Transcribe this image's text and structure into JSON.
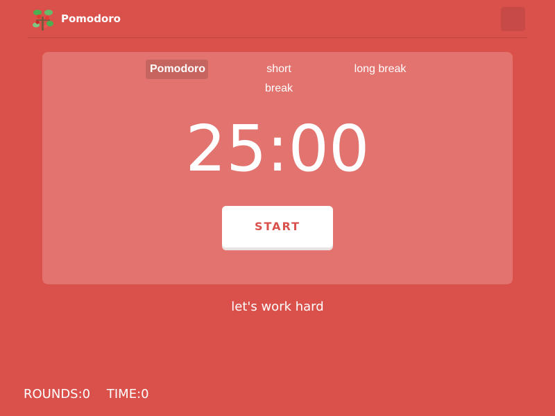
{
  "app": {
    "title": "Pomodoro",
    "logo_icon": "tomato-plant-icon",
    "settings_icon": "settings-icon"
  },
  "tabs": [
    {
      "label": "Pomodoro",
      "active": true
    },
    {
      "label": "short break",
      "active": false
    },
    {
      "label": "long break",
      "active": false
    }
  ],
  "timer": {
    "display": "25:00"
  },
  "controls": {
    "start_label": "START"
  },
  "motto": "let's work hard",
  "stats": {
    "rounds_label": "ROUNDS:",
    "rounds_value": "0",
    "time_label": "TIME:",
    "time_value": "0"
  },
  "colors": {
    "background": "#DA514C",
    "panel": "#E2736E",
    "button_text": "#DA514C",
    "text": "#FFFFFF"
  }
}
